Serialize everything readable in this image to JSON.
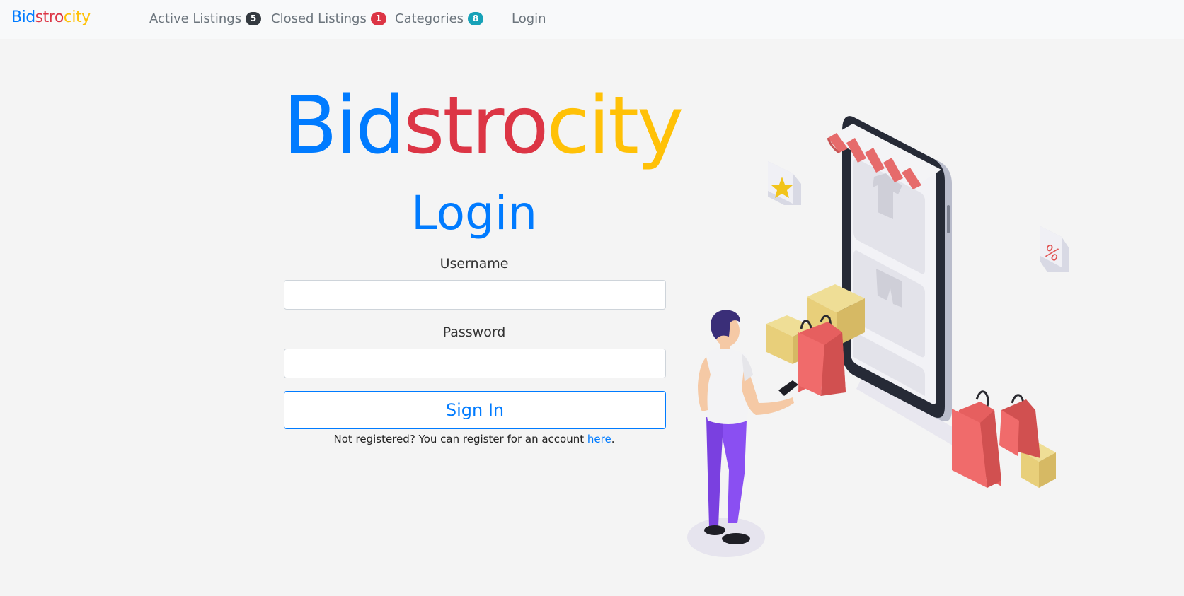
{
  "navbar": {
    "brand": {
      "part1": "Bid",
      "part2": "stro",
      "part3": "city"
    },
    "items": [
      {
        "label": "Active Listings",
        "badge": "5"
      },
      {
        "label": "Closed Listings",
        "badge": "1"
      },
      {
        "label": "Categories",
        "badge": "8"
      }
    ],
    "login_label": "Login"
  },
  "hero": {
    "title": {
      "part1": "Bid",
      "part2": "stro",
      "part3": "city"
    },
    "subtitle": "Login"
  },
  "form": {
    "username_label": "Username",
    "username_value": "",
    "password_label": "Password",
    "password_value": "",
    "submit_label": "Sign In",
    "register_text": "Not registered? You can register for an account ",
    "register_link": "here",
    "register_end": "."
  },
  "illustration": {
    "star_icon": "star-icon",
    "percent_label": "%"
  },
  "colors": {
    "blue": "#007bff",
    "red": "#dc3545",
    "yellow": "#ffc107"
  }
}
